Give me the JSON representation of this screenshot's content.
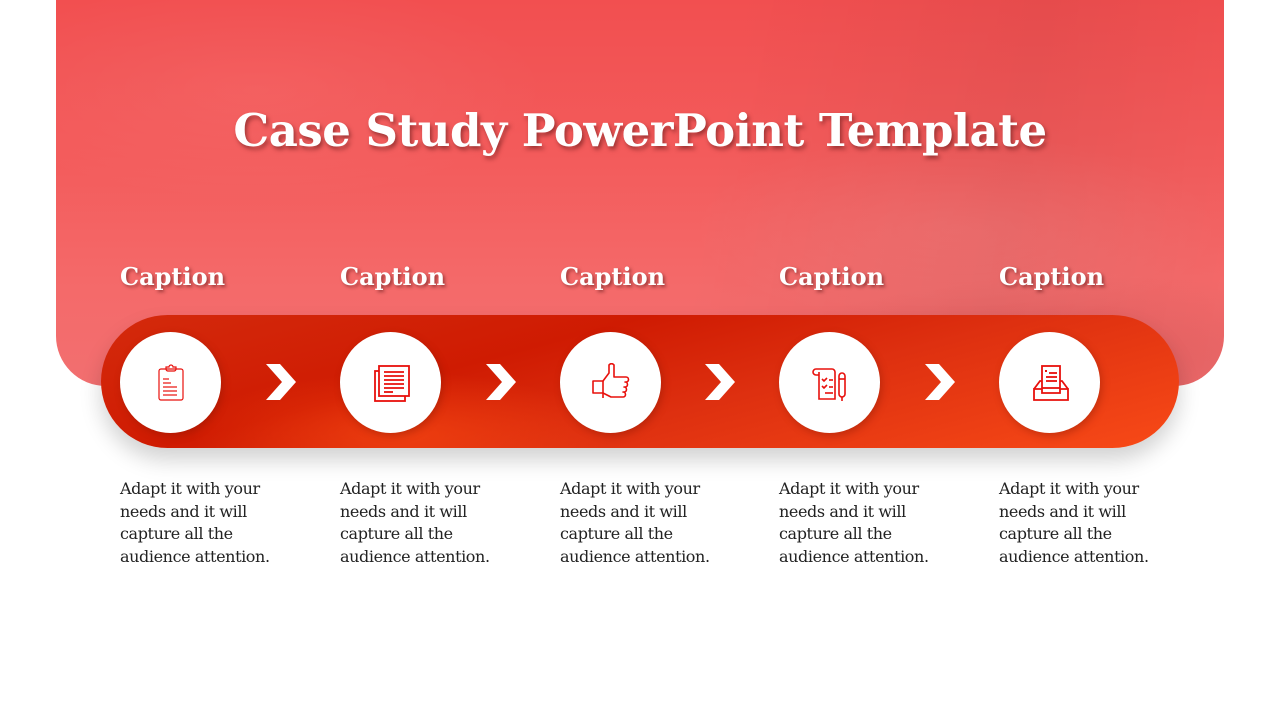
{
  "slide": {
    "title": "Case Study PowerPoint Template",
    "accent_color": "#e8100c",
    "steps": [
      {
        "caption": "Caption",
        "icon": "clipboard-icon",
        "text": "Adapt it with your needs and it will capture all the audience attention."
      },
      {
        "caption": "Caption",
        "icon": "documents-icon",
        "text": "Adapt it with your needs and it will capture all the audience attention."
      },
      {
        "caption": "Caption",
        "icon": "thumbs-up-icon",
        "text": "Adapt it with your needs and it will capture all the audience attention."
      },
      {
        "caption": "Caption",
        "icon": "notepad-pen-icon",
        "text": "Adapt it with your needs and it will capture all the audience attention."
      },
      {
        "caption": "Caption",
        "icon": "inbox-tray-icon",
        "text": "Adapt it with your needs and it will capture all the audience attention."
      }
    ]
  }
}
